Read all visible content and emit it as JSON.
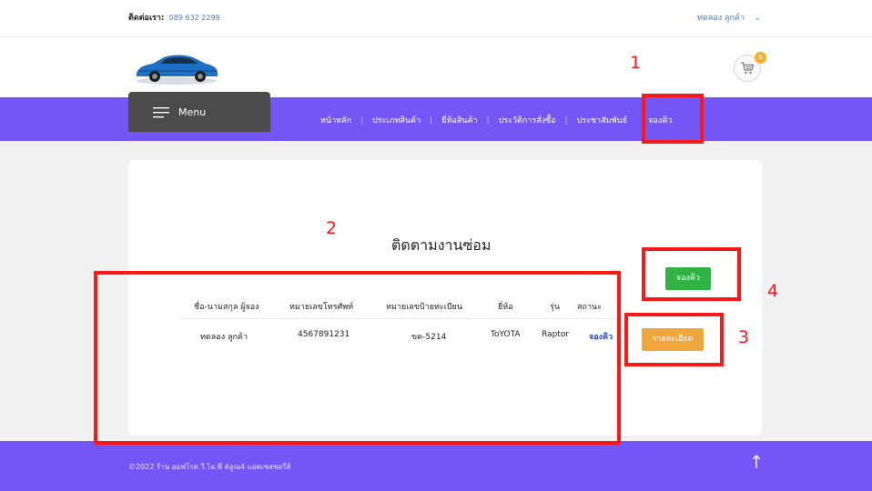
{
  "topbar": {
    "contact_label": "ติดต่อเรา:",
    "contact_phone": "089 632 2299",
    "account_name": "ทดลอง ลูกค้า",
    "account_chevron": "⌄"
  },
  "header": {
    "logo_icon": "car-logo-icon",
    "cart_icon": "shopping-cart-icon",
    "cart_count": "0"
  },
  "menu": {
    "label": "Menu",
    "icon": "hamburger-icon"
  },
  "nav": {
    "items": [
      {
        "label": "หน้าหลัก"
      },
      {
        "label": "ประเภทสินค้า"
      },
      {
        "label": "ยี่ห้อสินค้า"
      },
      {
        "label": "ประวัติการสั่งซื้อ"
      },
      {
        "label": "ประชาสัมพันธ์"
      },
      {
        "label": "จองคิว"
      }
    ],
    "separator": "|"
  },
  "main": {
    "title": "ติดตามงานซ่อม",
    "book_button": "จองคิว",
    "table": {
      "headers": [
        "ชื่อ-นามสกุล ผู้จอง",
        "หมายเลขโทรศัพท์",
        "หมายเลขป้ายทะเบียน",
        "ยี่ห้อ",
        "รุ่น",
        "สถานะ"
      ],
      "rows": [
        {
          "name": "ทดลอง ลูกค้า",
          "phone": "4567891231",
          "plate": "ขค-5214",
          "brand": "ToYOTA",
          "model": "Raptor",
          "status": "จองคิว",
          "detail_button": "รายละเอียด"
        }
      ]
    }
  },
  "footer": {
    "copyright": "©2022 ร้าน ออฟโรด วี.ไอ.พี 4ลูณ4 แอคเซสซอรี่ส์",
    "up_icon": "arrow-up-icon"
  },
  "annotations": [
    "1",
    "2",
    "3",
    "4"
  ],
  "colors": {
    "nav_bg": "#7357f6",
    "menu_bg": "#4b4b4b",
    "book_button": "#2fb344",
    "detail_button": "#efa63c",
    "annotation": "#ff1717",
    "link": "#4a79c9"
  }
}
